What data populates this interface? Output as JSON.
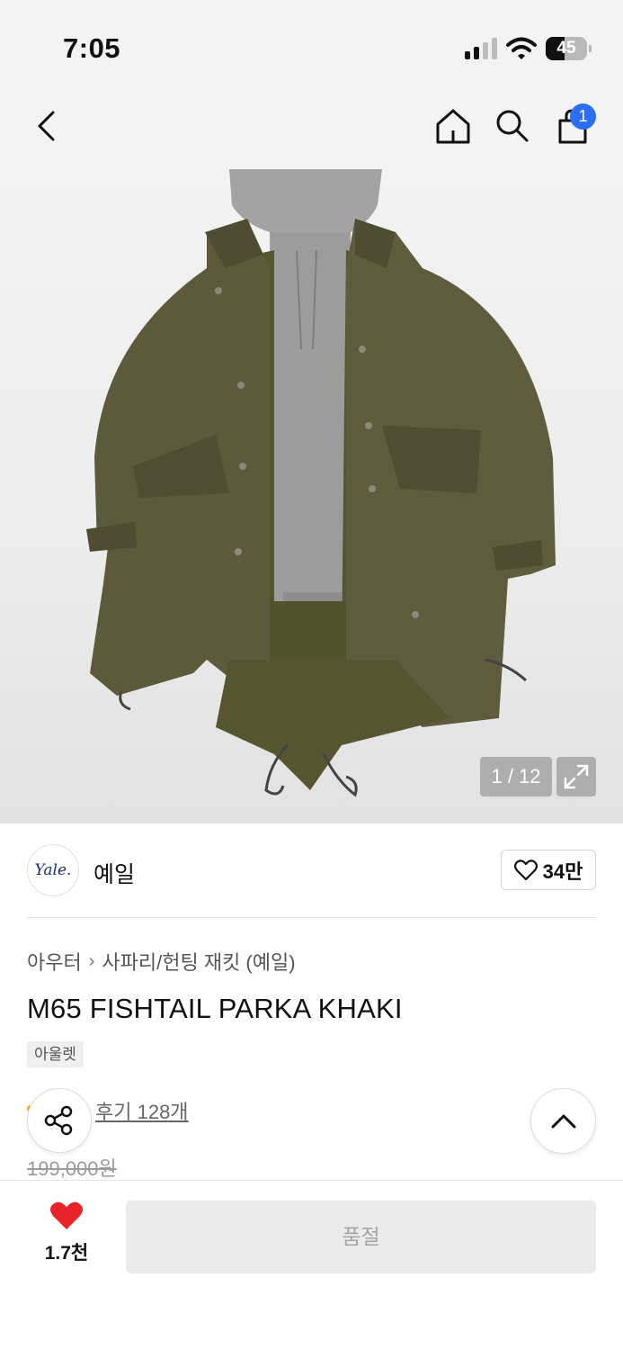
{
  "status_bar": {
    "time": "7:05",
    "battery": "45",
    "battery_level": 0.45
  },
  "nav": {
    "back_icon": "chevron-left-icon",
    "home_icon": "home-icon",
    "search_icon": "search-icon",
    "cart_icon": "shopping-bag-icon",
    "cart_count": "1"
  },
  "gallery": {
    "page_indicator": "1 / 12",
    "expand_icon": "expand-icon"
  },
  "brand": {
    "logo_text": "Yale.",
    "name": "예일",
    "likes": "34만"
  },
  "breadcrumb": {
    "category": "아우터",
    "subcategory": "사파리/헌팅 재킷 (예일)"
  },
  "product": {
    "title": "M65 FISHTAIL PARKA KHAKI",
    "badge": "아울렛",
    "reviews": "후기 128개",
    "original_price": "199,000원"
  },
  "bottom_bar": {
    "wish_count": "1.7천",
    "soldout_label": "품절"
  },
  "colors": {
    "accent_blue": "#2b6ff2",
    "heart_red": "#e8232a",
    "disabled_bg": "#ebebeb"
  }
}
